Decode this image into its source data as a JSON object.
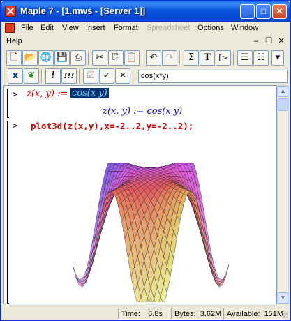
{
  "window": {
    "title": "Maple 7  - [1.mws - [Server 1]]"
  },
  "menu": {
    "items": [
      "File",
      "Edit",
      "View",
      "Insert",
      "Format",
      "Spreadsheet",
      "Options",
      "Window"
    ],
    "help": "Help"
  },
  "toolbar1": {
    "buttons": [
      "new-file",
      "open",
      "open-url",
      "save",
      "print",
      "cut",
      "copy",
      "paste",
      "undo",
      "redo",
      "sigma",
      "text",
      "execute-group",
      "indent",
      "outdent"
    ],
    "sigma_label": "Σ",
    "text_label": "T",
    "exec_label": "[>"
  },
  "toolbar2": {
    "x_label": "x",
    "bang1_label": "!",
    "bang3_label": "!!!",
    "check_label": "✓",
    "times_label": "✕",
    "command": "cos(x*y)"
  },
  "worksheet": {
    "prompt1": ">",
    "input1_lhs": "z(x, y) :=",
    "input1_rhs": "cos(x y)",
    "output1": "z(x, y) := cos(x y)",
    "prompt2": ">",
    "input2": "plot3d(z(x,y),x=-2..2,y=-2..2);"
  },
  "plot": {
    "function": "cos(x*y)",
    "x_range": [
      -2,
      2
    ],
    "y_range": [
      -2,
      2
    ]
  },
  "status": {
    "time_label": "Time:",
    "time_value": "6.8s",
    "bytes_label": "Bytes:",
    "bytes_value": "3.62M",
    "available_label": "Available:",
    "available_value": "151M"
  }
}
